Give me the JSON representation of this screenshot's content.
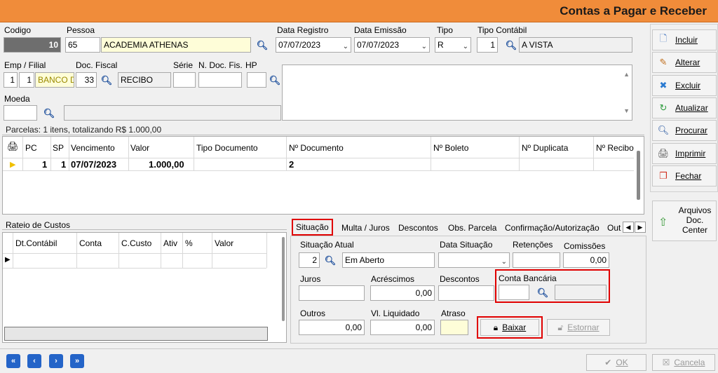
{
  "window": {
    "title": "Contas a Pagar e Receber"
  },
  "header": {
    "codigo_label": "Codigo",
    "codigo_value": "10",
    "pessoa_label": "Pessoa",
    "pessoa_code": "65",
    "pessoa_name": "ACADEMIA ATHENAS",
    "data_registro_label": "Data Registro",
    "data_registro_value": "07/07/2023",
    "data_emissao_label": "Data Emissão",
    "data_emissao_value": "07/07/2023",
    "tipo_label": "Tipo",
    "tipo_value": "R",
    "tipo_contabil_label": "Tipo Contábil",
    "tipo_contabil_code": "1",
    "tipo_contabil_name": "A VISTA",
    "emp_filial_label": "Emp / Filial",
    "emp_value": "1",
    "filial_value": "1",
    "banco_value": "BANCO D",
    "doc_fiscal_label": "Doc. Fiscal",
    "doc_fiscal_code": "33",
    "doc_fiscal_name": "RECIBO",
    "serie_label": "Série",
    "serie_value": "",
    "n_doc_fis_label": "N. Doc. Fis.",
    "n_doc_fis_value": "",
    "hp_label": "HP",
    "hp_value": "",
    "moeda_label": "Moeda",
    "moeda_value": "",
    "obs_value": ""
  },
  "parcelas": {
    "summary": "Parcelas: 1 itens, totalizando R$ 1.000,00",
    "columns": [
      "PC",
      "SP",
      "Vencimento",
      "Valor",
      "Tipo Documento",
      "Nº Documento",
      "Nº Boleto",
      "Nº Duplicata",
      "Nº Recibo"
    ],
    "rows": [
      {
        "pc": "1",
        "sp": "1",
        "vencimento": "07/07/2023",
        "valor": "1.000,00",
        "tipo_documento": "",
        "n_documento": "2",
        "n_boleto": "",
        "n_duplicata": "",
        "n_recibo": ""
      }
    ]
  },
  "rateio": {
    "title": "Rateio de Custos",
    "columns": [
      "Dt.Contábil",
      "Conta",
      "C.Custo",
      "Ativ",
      "%",
      "Valor"
    ]
  },
  "tabs": [
    "Situação",
    "Multa / Juros",
    "Descontos",
    "Obs. Parcela",
    "Confirmação/Autorização",
    "Out"
  ],
  "situacao": {
    "situacao_atual_label": "Situação Atual",
    "situacao_code": "2",
    "situacao_name": "Em Aberto",
    "data_situacao_label": "Data Situação",
    "data_situacao_value": "",
    "retencoes_label": "Retenções",
    "retencoes_value": "",
    "comissoes_label": "Comissões",
    "comissoes_value": "0,00",
    "juros_label": "Juros",
    "juros_value": "",
    "acrescimos_label": "Acréscimos",
    "acrescimos_value": "0,00",
    "descontos_label": "Descontos",
    "descontos_value": "",
    "conta_bancaria_label": "Conta Bancária",
    "conta_bancaria_code": "",
    "conta_bancaria_name": "",
    "outros_label": "Outros",
    "outros_value": "0,00",
    "vl_liquidado_label": "Vl. Liquidado",
    "vl_liquidado_value": "0,00",
    "atraso_label": "Atraso",
    "atraso_value": "",
    "baixar_label": "Baixar",
    "estornar_label": "Estornar"
  },
  "sidebar": {
    "incluir": "Incluir",
    "alterar": "Alterar",
    "excluir": "Excluir",
    "atualizar": "Atualizar",
    "procurar": "Procurar",
    "imprimir": "Imprimir",
    "fechar": "Fechar",
    "arquivos_l1": "Arquivos",
    "arquivos_l2": "Doc.",
    "arquivos_l3": "Center"
  },
  "footer": {
    "ok_label": "OK",
    "cancela_label": "Cancela"
  },
  "colors": {
    "title_bar": "#f08c3a",
    "highlight": "#e00000",
    "nav": "#2464c8"
  }
}
